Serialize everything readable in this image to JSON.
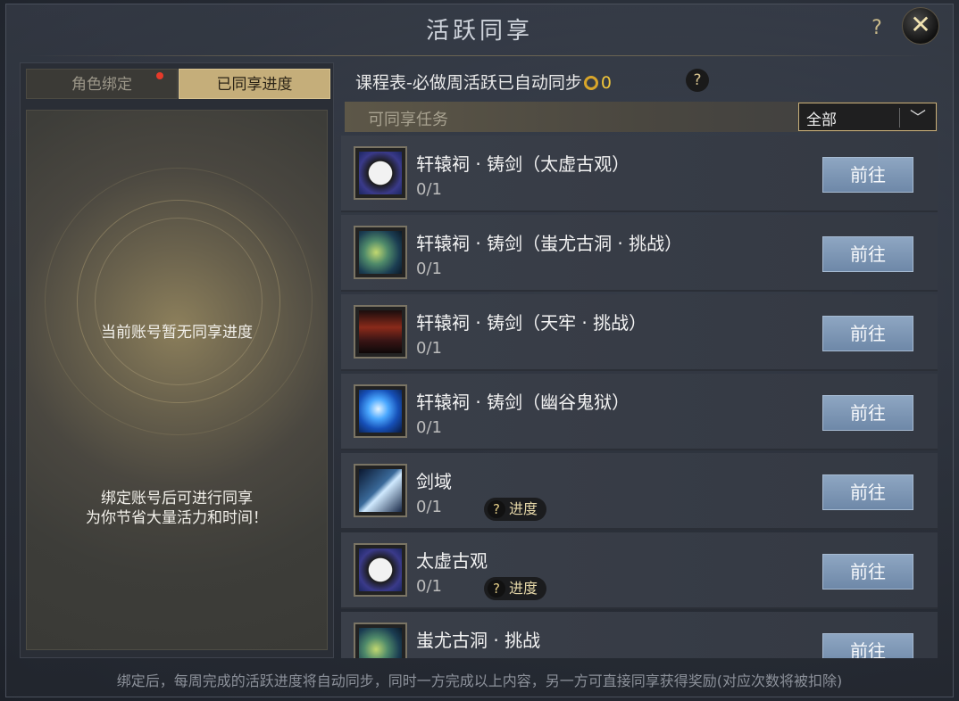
{
  "title": "活跃同享",
  "top_help_label": "?",
  "close_label": "✕",
  "tabs": [
    {
      "label": "角色绑定"
    },
    {
      "label": "已同享进度"
    }
  ],
  "left": {
    "empty_text": "当前账号暂无同享进度",
    "bind_line1": "绑定账号后可进行同享",
    "bind_line2": "为你节省大量活力和时间！"
  },
  "sync": {
    "text": "课程表-必做周活跃已自动同步",
    "count": "0",
    "help_label": "?"
  },
  "filter": {
    "label": "可同享任务",
    "selected": "全部",
    "arrow": "﹀"
  },
  "tasks": [
    {
      "name": "轩辕祠 · 铸剑（太虚古观）",
      "count": "0/1",
      "icon": "taiji-icon",
      "button": "前往"
    },
    {
      "name": "轩辕祠 · 铸剑（蚩尤古洞 · 挑战）",
      "count": "0/1",
      "icon": "dragon-icon",
      "button": "前往"
    },
    {
      "name": "轩辕祠 · 铸剑（天牢 · 挑战）",
      "count": "0/1",
      "icon": "temple-icon",
      "button": "前往"
    },
    {
      "name": "轩辕祠 · 铸剑（幽谷鬼狱）",
      "count": "0/1",
      "icon": "orb-icon",
      "button": "前往"
    },
    {
      "name": "剑域",
      "count": "0/1",
      "icon": "sword-icon",
      "button": "前往",
      "progress_label": "进度"
    },
    {
      "name": "太虚古观",
      "count": "0/1",
      "icon": "taiji-icon",
      "button": "前往",
      "progress_label": "进度"
    },
    {
      "name": "蚩尤古洞 · 挑战",
      "count": "",
      "icon": "dragon-icon",
      "button": "前往"
    }
  ],
  "pill_q": "?",
  "footer": "绑定后，每周完成的活跃进度将自动同步，同时一方完成以上内容，另一方可直接同享获得奖励(对应次数将被扣除)"
}
